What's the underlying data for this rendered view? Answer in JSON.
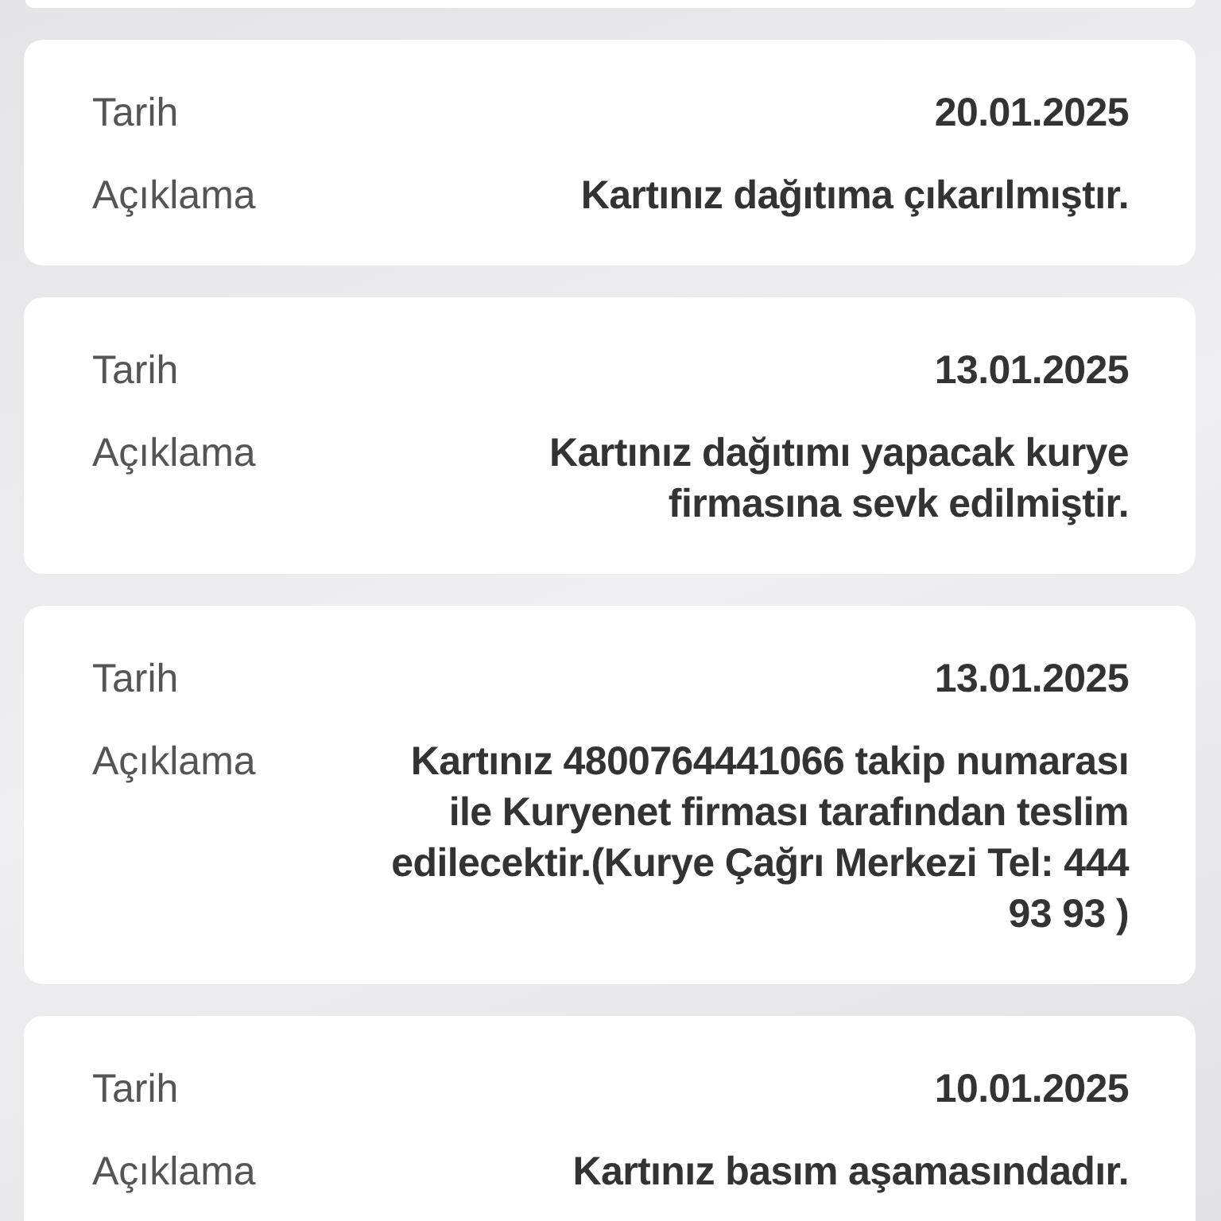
{
  "records": [
    {
      "rows": [
        {
          "label": "Tarih",
          "value": "20.01.2025"
        },
        {
          "label": "Açıklama",
          "value": "Kartınız dağıtıma çıkarılmıştır."
        }
      ]
    },
    {
      "rows": [
        {
          "label": "Tarih",
          "value": "13.01.2025"
        },
        {
          "label": "Açıklama",
          "value": "Kartınız dağıtımı yapacak kurye firmasına sevk edilmiştir."
        }
      ]
    },
    {
      "rows": [
        {
          "label": "Tarih",
          "value": "13.01.2025"
        },
        {
          "label": "Açıklama",
          "value": "Kartınız 4800764441066 takip numarası ile Kuryenet firması tarafından teslim edilecektir.(Kurye Çağrı Merkezi Tel: 444 93 93 )"
        }
      ]
    },
    {
      "rows": [
        {
          "label": "Tarih",
          "value": "10.01.2025"
        },
        {
          "label": "Açıklama",
          "value": "Kartınız basım aşamasındadır."
        }
      ]
    }
  ]
}
